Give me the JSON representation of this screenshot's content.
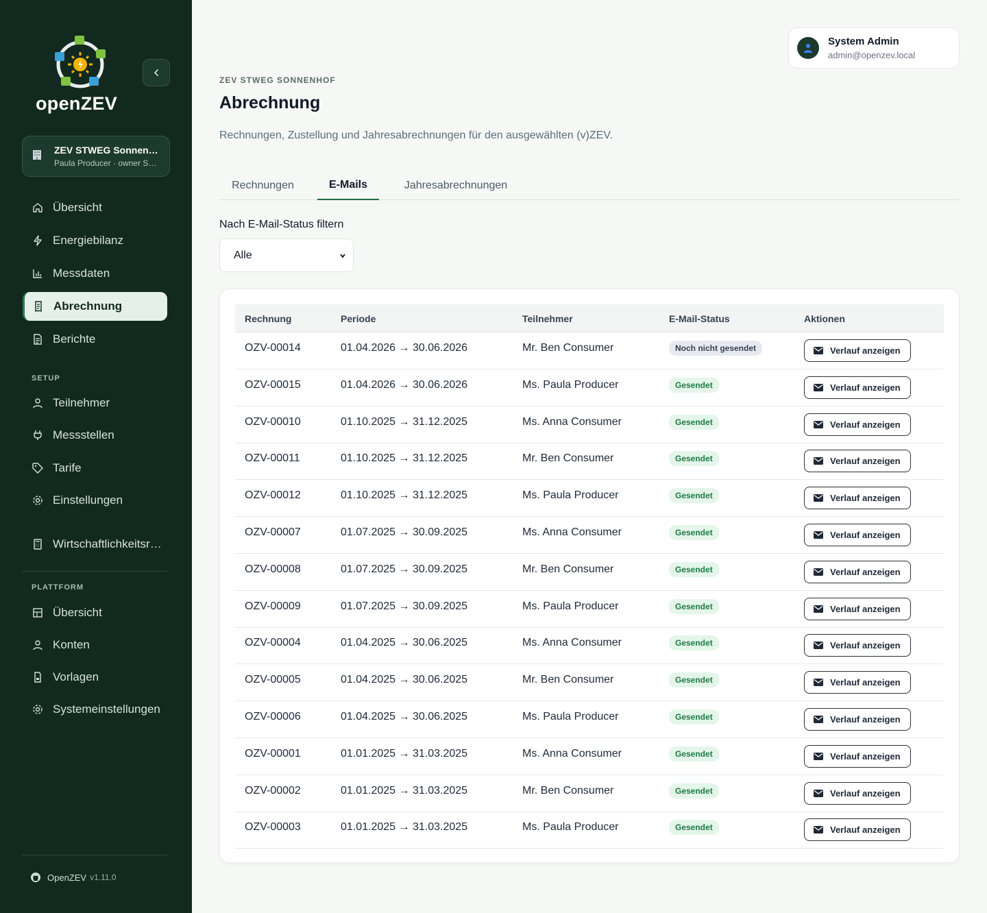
{
  "app": {
    "name": "openZEV",
    "collapse_icon": "chevron-left-icon"
  },
  "zev_selector": {
    "name": "ZEV STWEG Sonnenhof",
    "subtitle": "Paula Producer · owner Sonnenhof",
    "icon": "building-icon"
  },
  "sidebar": {
    "main_items": [
      {
        "label": "Übersicht",
        "icon": "home-icon",
        "active": false
      },
      {
        "label": "Energiebilanz",
        "icon": "bolt-icon",
        "active": false
      },
      {
        "label": "Messdaten",
        "icon": "bar-chart-icon",
        "active": false
      },
      {
        "label": "Abrechnung",
        "icon": "receipt-icon",
        "active": true
      },
      {
        "label": "Berichte",
        "icon": "document-icon",
        "active": false
      }
    ],
    "setup_title": "SETUP",
    "setup_items": [
      {
        "label": "Teilnehmer",
        "icon": "user-icon"
      },
      {
        "label": "Messstellen",
        "icon": "plug-icon"
      },
      {
        "label": "Tarife",
        "icon": "tag-icon"
      },
      {
        "label": "Einstellungen",
        "icon": "gear-icon"
      }
    ],
    "extra_item": {
      "label": "Wirtschaftlichkeitsrechner",
      "icon": "calculator-icon"
    },
    "platform_title": "PLATTFORM",
    "platform_items": [
      {
        "label": "Übersicht",
        "icon": "dashboard-icon"
      },
      {
        "label": "Konten",
        "icon": "user-icon"
      },
      {
        "label": "Vorlagen",
        "icon": "template-icon"
      },
      {
        "label": "Systemeinstellungen",
        "icon": "gear-icon"
      }
    ],
    "footer": {
      "label": "OpenZEV",
      "version": "v1.11.0",
      "icon": "github-icon"
    }
  },
  "user": {
    "name": "System Admin",
    "email": "admin@openzev.local",
    "icon": "user-avatar-icon"
  },
  "page": {
    "eyebrow": "ZEV STWEG SONNENHOF",
    "title": "Abrechnung",
    "subtitle": "Rechnungen, Zustellung und Jahresabrechnungen für den ausgewählten (v)ZEV."
  },
  "tabs": [
    {
      "label": "Rechnungen",
      "active": false
    },
    {
      "label": "E-Mails",
      "active": true
    },
    {
      "label": "Jahresabrechnungen",
      "active": false
    }
  ],
  "filter": {
    "label": "Nach E-Mail-Status filtern",
    "selected": "Alle"
  },
  "table": {
    "columns": [
      "Rechnung",
      "Periode",
      "Teilnehmer",
      "E-Mail-Status",
      "Aktionen"
    ],
    "action_label": "Verlauf anzeigen",
    "rows": [
      {
        "invoice": "OZV-00014",
        "period": "01.04.2026 → 30.06.2026",
        "participant": "Mr. Ben Consumer",
        "status": "Noch nicht gesendet",
        "sent": false
      },
      {
        "invoice": "OZV-00015",
        "period": "01.04.2026 → 30.06.2026",
        "participant": "Ms. Paula Producer",
        "status": "Gesendet",
        "sent": true
      },
      {
        "invoice": "OZV-00010",
        "period": "01.10.2025 → 31.12.2025",
        "participant": "Ms. Anna Consumer",
        "status": "Gesendet",
        "sent": true
      },
      {
        "invoice": "OZV-00011",
        "period": "01.10.2025 → 31.12.2025",
        "participant": "Mr. Ben Consumer",
        "status": "Gesendet",
        "sent": true
      },
      {
        "invoice": "OZV-00012",
        "period": "01.10.2025 → 31.12.2025",
        "participant": "Ms. Paula Producer",
        "status": "Gesendet",
        "sent": true
      },
      {
        "invoice": "OZV-00007",
        "period": "01.07.2025 → 30.09.2025",
        "participant": "Ms. Anna Consumer",
        "status": "Gesendet",
        "sent": true
      },
      {
        "invoice": "OZV-00008",
        "period": "01.07.2025 → 30.09.2025",
        "participant": "Mr. Ben Consumer",
        "status": "Gesendet",
        "sent": true
      },
      {
        "invoice": "OZV-00009",
        "period": "01.07.2025 → 30.09.2025",
        "participant": "Ms. Paula Producer",
        "status": "Gesendet",
        "sent": true
      },
      {
        "invoice": "OZV-00004",
        "period": "01.04.2025 → 30.06.2025",
        "participant": "Ms. Anna Consumer",
        "status": "Gesendet",
        "sent": true
      },
      {
        "invoice": "OZV-00005",
        "period": "01.04.2025 → 30.06.2025",
        "participant": "Mr. Ben Consumer",
        "status": "Gesendet",
        "sent": true
      },
      {
        "invoice": "OZV-00006",
        "period": "01.04.2025 → 30.06.2025",
        "participant": "Ms. Paula Producer",
        "status": "Gesendet",
        "sent": true
      },
      {
        "invoice": "OZV-00001",
        "period": "01.01.2025 → 31.03.2025",
        "participant": "Ms. Anna Consumer",
        "status": "Gesendet",
        "sent": true
      },
      {
        "invoice": "OZV-00002",
        "period": "01.01.2025 → 31.03.2025",
        "participant": "Mr. Ben Consumer",
        "status": "Gesendet",
        "sent": true
      },
      {
        "invoice": "OZV-00003",
        "period": "01.01.2025 → 31.03.2025",
        "participant": "Ms. Paula Producer",
        "status": "Gesendet",
        "sent": true
      }
    ]
  },
  "colors": {
    "sidebar_bg": "#12291f",
    "accent": "#1f6b45",
    "sent_badge_bg": "#e4f5e9",
    "sent_badge_text": "#1f7a44",
    "notsent_badge_bg": "#e6eaf0"
  }
}
